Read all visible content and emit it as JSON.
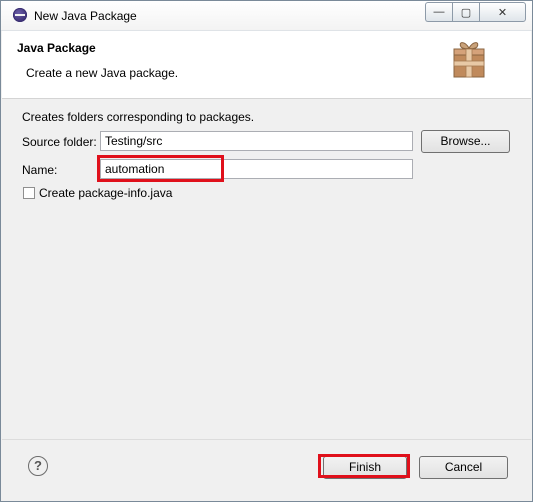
{
  "window": {
    "title": "New Java Package",
    "controls": {
      "minimize": "—",
      "maximize": "▢",
      "close": "✕"
    }
  },
  "banner": {
    "title": "Java Package",
    "description": "Create a new Java package.",
    "icon": "package-icon"
  },
  "form": {
    "intro": "Creates folders corresponding to packages.",
    "source_folder_label": "Source folder:",
    "source_folder_value": "Testing/src",
    "browse_label": "Browse...",
    "name_label": "Name:",
    "name_value": "automation",
    "create_package_info_label": "Create package-info.java",
    "create_package_info_checked": false
  },
  "footer": {
    "help_icon": "?",
    "finish_label": "Finish",
    "cancel_label": "Cancel"
  },
  "colors": {
    "highlight": "#e0101b",
    "dialog_bg": "#f0f0f0",
    "banner_bg": "#ffffff"
  }
}
